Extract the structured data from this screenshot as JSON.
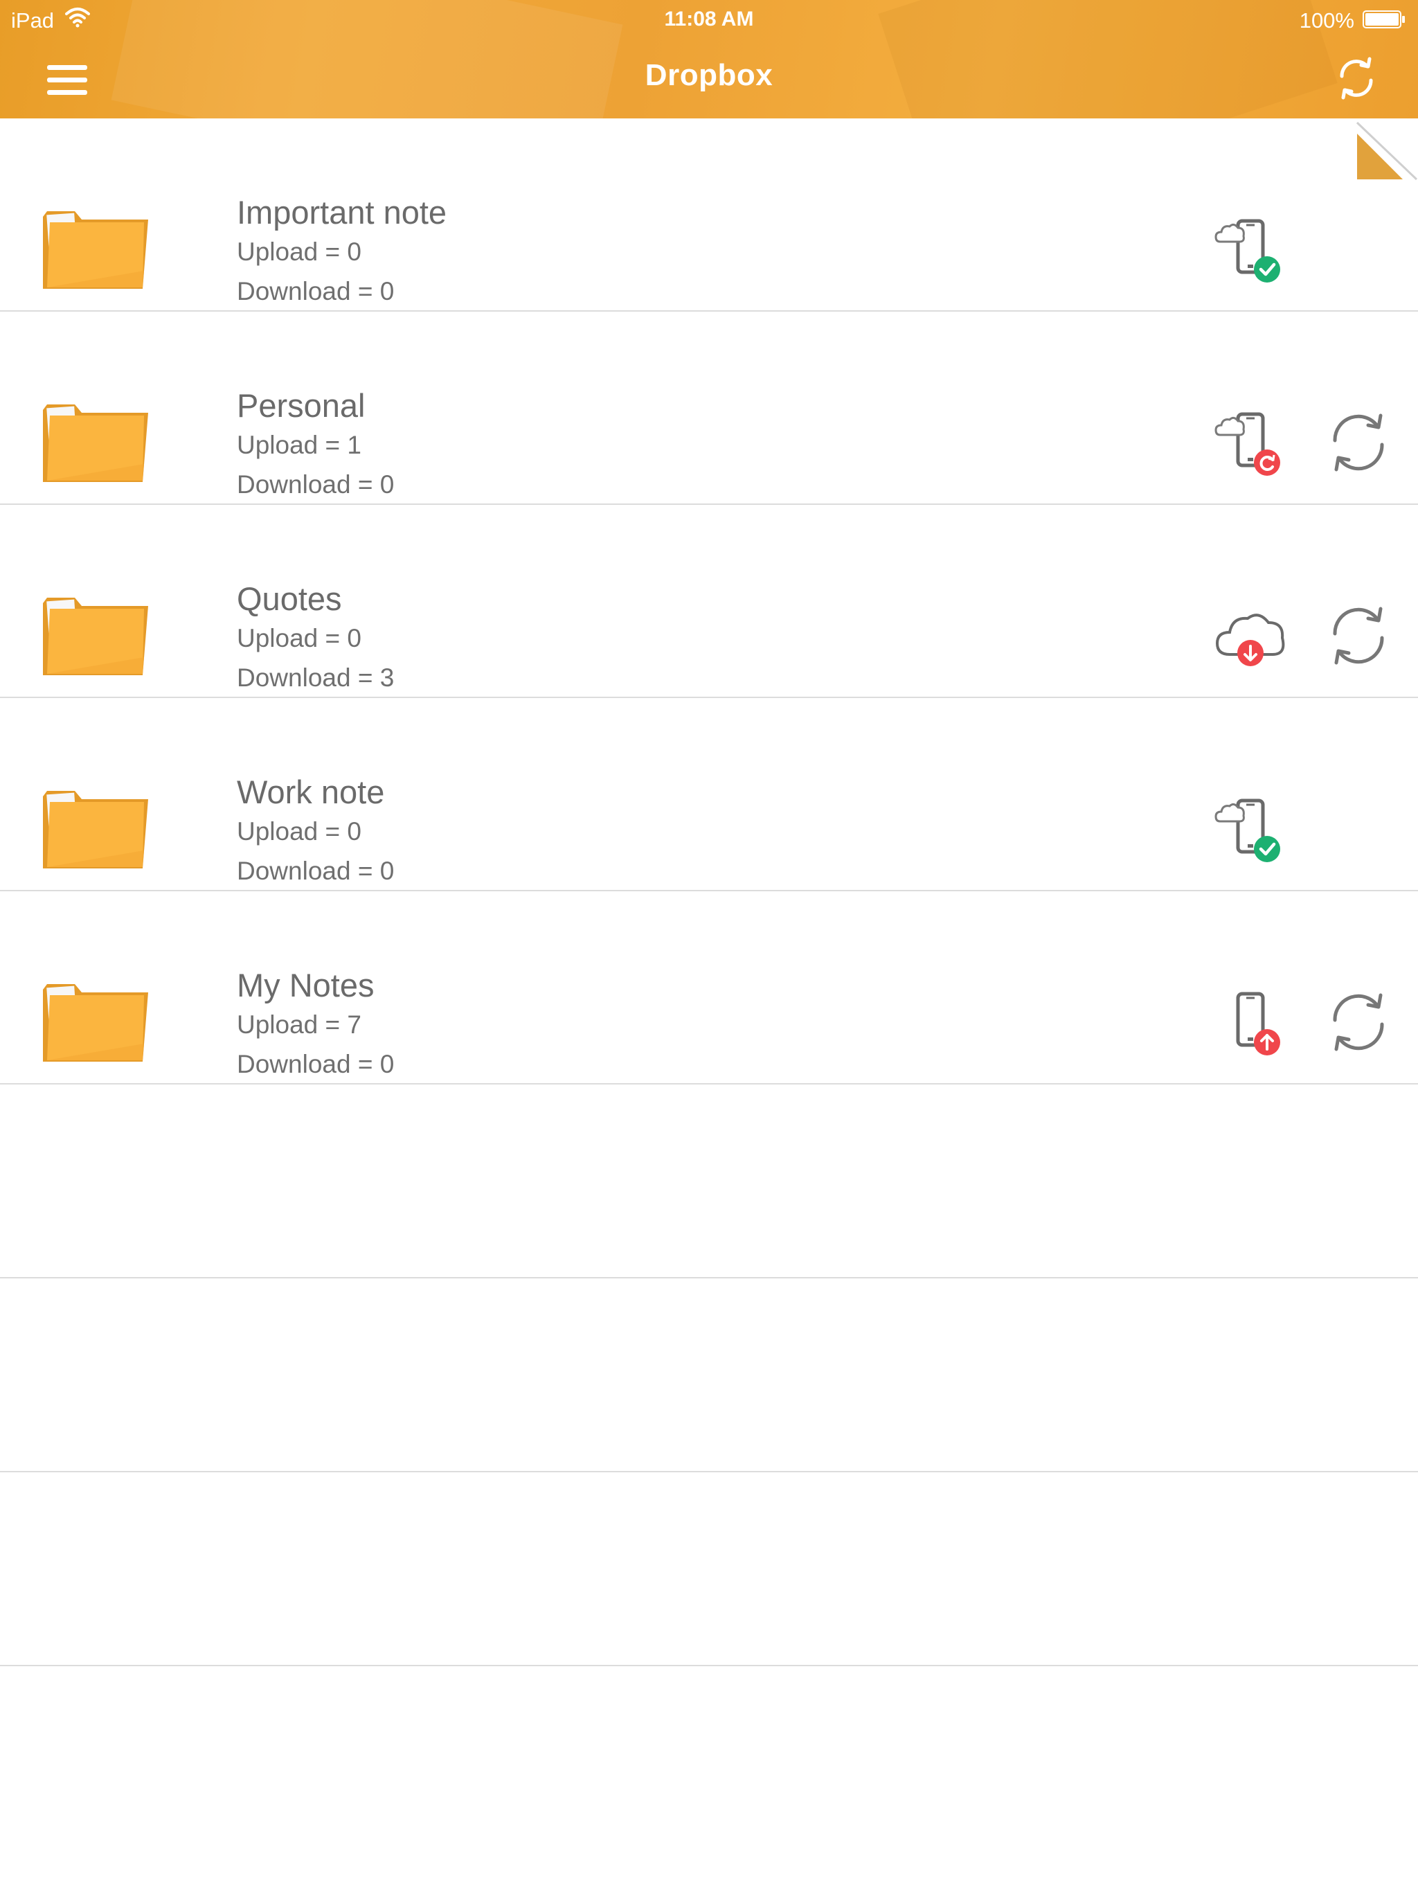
{
  "status_bar": {
    "carrier": "iPad",
    "time": "11:08 AM",
    "battery": "100%"
  },
  "nav": {
    "title": "Dropbox"
  },
  "colors": {
    "header": "#efa633",
    "folder": "#fbb53f",
    "ok_badge": "#1db071",
    "alert_badge": "#f0464b",
    "text": "#6a6a6a"
  },
  "items": [
    {
      "title": "Important note",
      "upload": "Upload = 0",
      "download": "Download = 0",
      "status": "phone-cloud-synced-icon",
      "has_sync": false
    },
    {
      "title": "Personal",
      "upload": "Upload = 1",
      "download": "Download = 0",
      "status": "phone-cloud-conflict-icon",
      "has_sync": true
    },
    {
      "title": "Quotes",
      "upload": "Upload = 0",
      "download": "Download = 3",
      "status": "cloud-download-pending-icon",
      "has_sync": true
    },
    {
      "title": "Work note",
      "upload": "Upload = 0",
      "download": "Download = 0",
      "status": "phone-cloud-synced-icon",
      "has_sync": false
    },
    {
      "title": "My Notes",
      "upload": "Upload = 7",
      "download": "Download = 0",
      "status": "phone-upload-pending-icon",
      "has_sync": true
    }
  ]
}
